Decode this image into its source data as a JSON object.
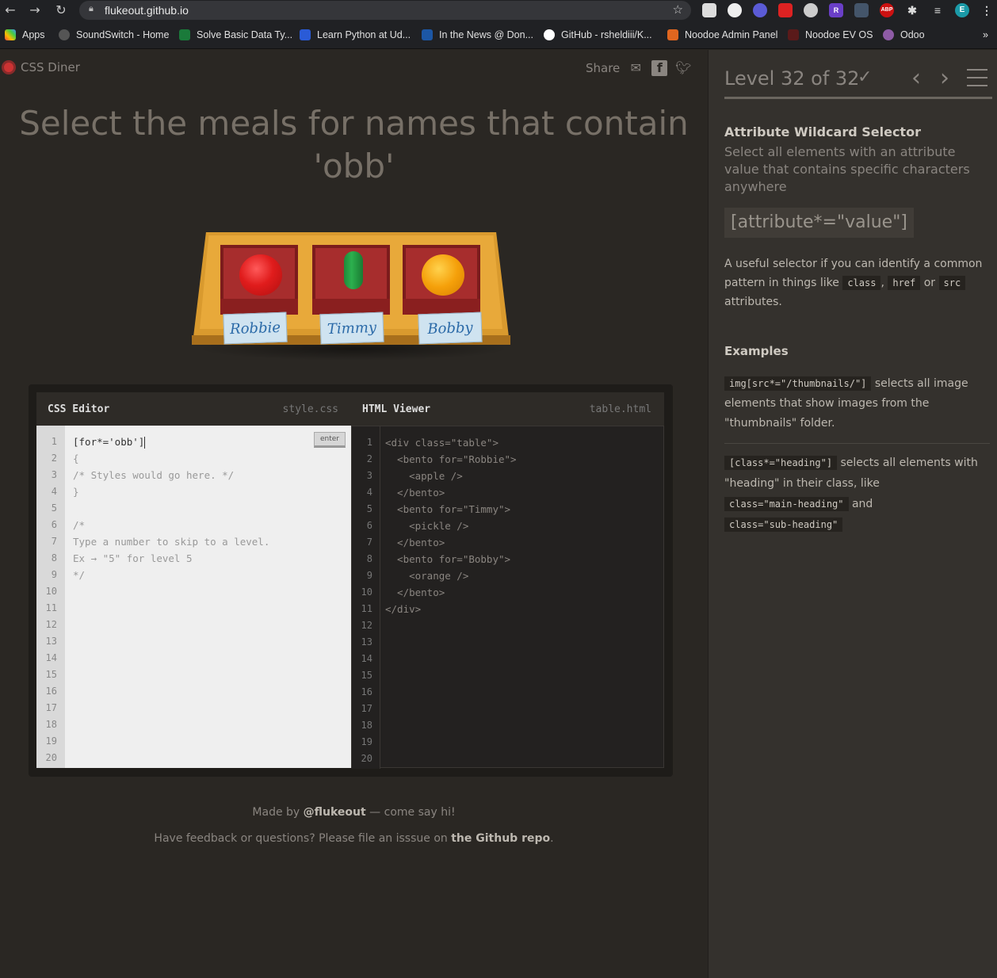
{
  "browser": {
    "url": "flukeout.github.io",
    "extensions": [
      "R",
      "ABP",
      "E"
    ],
    "bookmarks": [
      {
        "label": "Apps",
        "icon": "apps-grid-icon"
      },
      {
        "label": "SoundSwitch - Home",
        "icon": "soundswitch-icon"
      },
      {
        "label": "Solve Basic Data Ty...",
        "icon": "hackerrank-icon"
      },
      {
        "label": "Learn Python at Ud...",
        "icon": "udemy-icon"
      },
      {
        "label": "In the News @ Don...",
        "icon": "uci-icon"
      },
      {
        "label": "GitHub - rsheldiii/K...",
        "icon": "github-icon"
      },
      {
        "label": "Noodoe Admin Panel",
        "icon": "brave-icon"
      },
      {
        "label": "Noodoe EV OS",
        "icon": "noodoe-icon"
      },
      {
        "label": "Odoo",
        "icon": "odoo-icon"
      }
    ],
    "overflow": "»"
  },
  "game": {
    "logo": "CSS Diner",
    "share_label": "Share",
    "order": "Select the meals for names that contain 'obb'",
    "tags": [
      "Robbie",
      "Timmy",
      "Bobby"
    ]
  },
  "editor": {
    "css_title": "CSS Editor",
    "css_file": "style.css",
    "html_title": "HTML Viewer",
    "html_file": "table.html",
    "enter_label": "enter",
    "input_value": "[for*='obb']",
    "css_lines": [
      "{",
      "/* Styles would go here. */",
      "}",
      "",
      "/*",
      "Type a number to skip to a level.",
      "Ex → \"5\" for level 5",
      "*/"
    ],
    "html_lines": [
      "<div class=\"table\">",
      "  <bento for=\"Robbie\">",
      "    <apple />",
      "  </bento>",
      "  <bento for=\"Timmy\">",
      "    <pickle />",
      "  </bento>",
      "  <bento for=\"Bobby\">",
      "    <orange />",
      "  </bento>",
      "</div>"
    ],
    "line_count": 20
  },
  "footer": {
    "made_by_prefix": "Made by",
    "made_by_link": "@flukeout",
    "made_by_suffix": "— come say hi!",
    "feedback_prefix": "Have feedback or questions? Please file an isssue on",
    "feedback_link": "the Github repo",
    "feedback_suffix": "."
  },
  "sidebar": {
    "level": "Level 32 of 32",
    "progress": 1.0,
    "heading": "Attribute Wildcard Selector",
    "subheading": "Select all elements with an attribute value that contains specific characters anywhere",
    "syntax": "[attribute*=\"value\"]",
    "hint_a": "A useful selector if you can identify a common pattern in things like",
    "hint_tokens": [
      "class",
      "href",
      "src"
    ],
    "hint_sep1": ",",
    "hint_or": "or",
    "hint_end": "attributes.",
    "examples_heading": "Examples",
    "ex1_code": "img[src*=\"/thumbnails/\"]",
    "ex1_text": "selects all image elements that show images from the \"thumbnails\" folder.",
    "ex2_code": "[class*=\"heading\"]",
    "ex2_text_a": "selects all elements with \"heading\" in their class, like",
    "ex2_code2": "class=\"main-heading\"",
    "ex2_and": "and",
    "ex2_code3": "class=\"sub-heading\""
  }
}
